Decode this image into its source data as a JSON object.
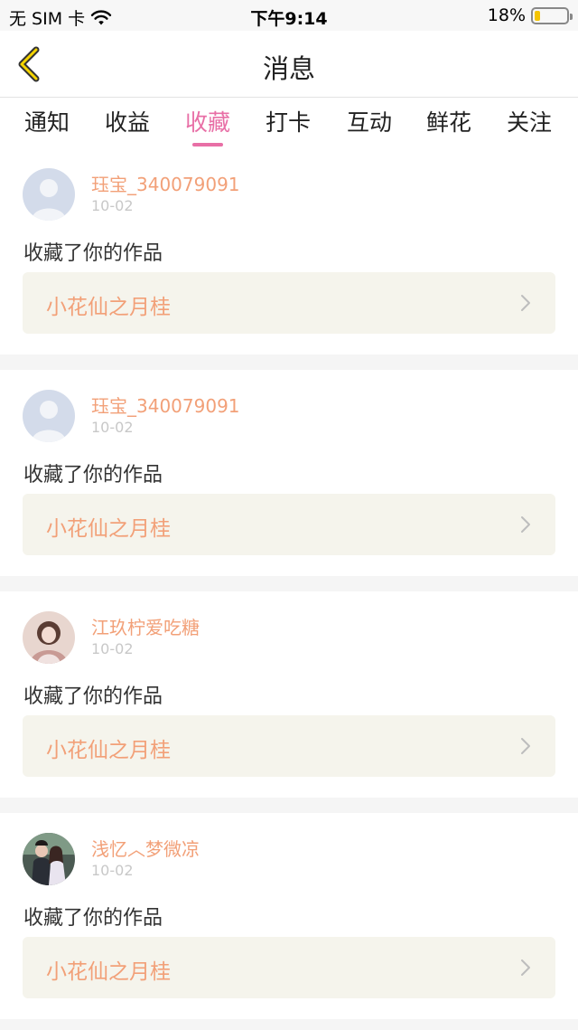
{
  "status_bar": {
    "carrier": "无 SIM 卡",
    "time": "下午9:14",
    "battery": "18%",
    "battery_level": 0.18
  },
  "nav": {
    "title": "消息"
  },
  "tabs": [
    {
      "label": "通知",
      "active": false
    },
    {
      "label": "收益",
      "active": false
    },
    {
      "label": "收藏",
      "active": true
    },
    {
      "label": "打卡",
      "active": false
    },
    {
      "label": "互动",
      "active": false
    },
    {
      "label": "鲜花",
      "active": false
    },
    {
      "label": "关注",
      "active": false
    }
  ],
  "messages": [
    {
      "username": "珏宝_340079091",
      "date": "10-02",
      "action": "收藏了你的作品",
      "work_title": "小花仙之月桂",
      "avatar": "default-avatar"
    },
    {
      "username": "珏宝_340079091",
      "date": "10-02",
      "action": "收藏了你的作品",
      "work_title": "小花仙之月桂",
      "avatar": "default-avatar"
    },
    {
      "username": "江玖柠爱吃糖",
      "date": "10-02",
      "action": "收藏了你的作品",
      "work_title": "小花仙之月桂",
      "avatar": "photo-avatar-girl"
    },
    {
      "username": "浅忆︿梦微凉",
      "date": "10-02",
      "action": "收藏了你的作品",
      "work_title": "小花仙之月桂",
      "avatar": "photo-avatar-couple"
    }
  ],
  "colors": {
    "accent": "#e86fa6",
    "username": "#f2a078",
    "work_box_bg": "#f5f4ec"
  }
}
